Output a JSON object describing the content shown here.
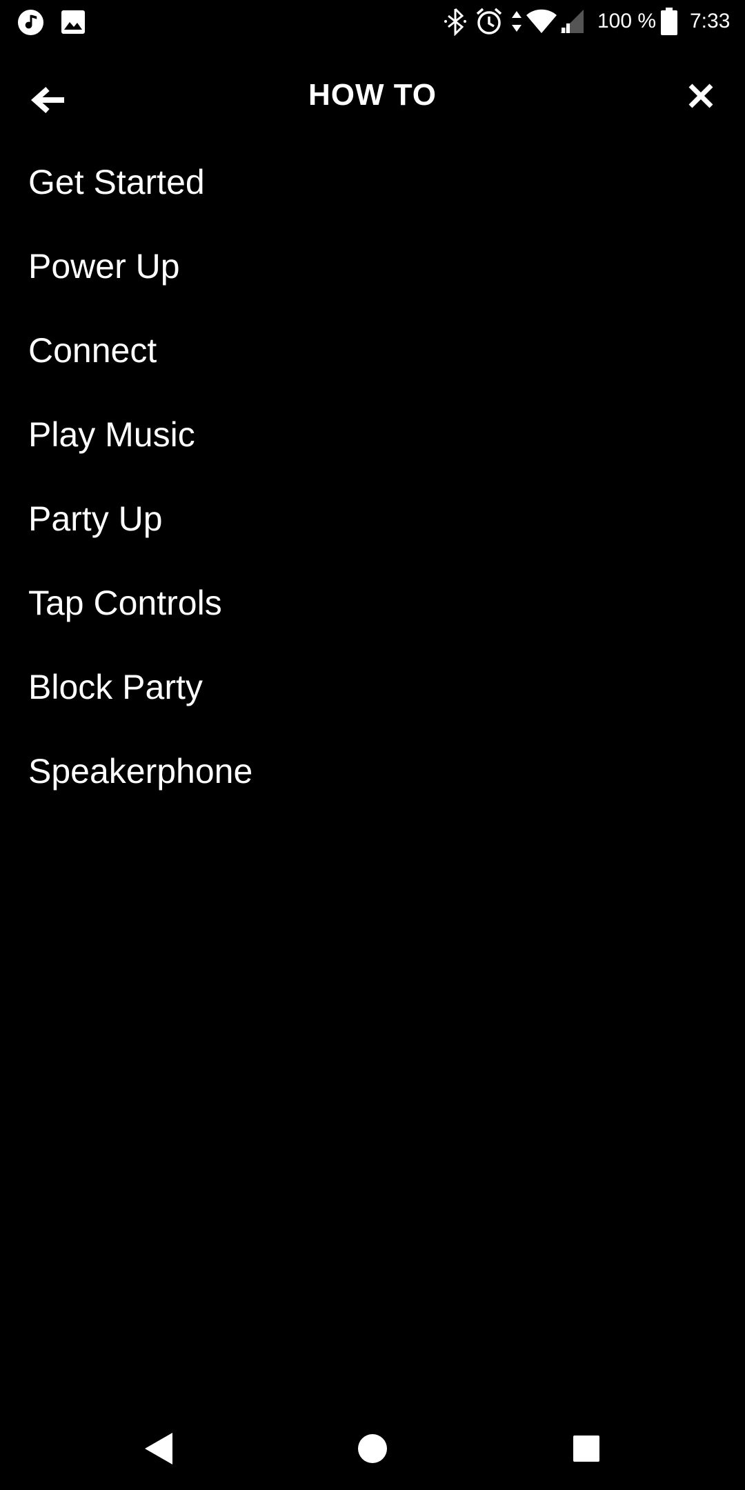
{
  "status_bar": {
    "battery_percent": "100 %",
    "time": "7:33",
    "icons": [
      "music-note-icon",
      "image-icon",
      "bluetooth-icon",
      "alarm-icon",
      "data-arrows-icon",
      "wifi-icon",
      "cellular-signal-icon",
      "battery-icon"
    ]
  },
  "header": {
    "title": "HOW TO",
    "back_icon": "arrow-left-icon",
    "close_icon": "close-icon"
  },
  "menu": {
    "items": [
      {
        "label": "Get Started"
      },
      {
        "label": "Power Up"
      },
      {
        "label": "Connect"
      },
      {
        "label": "Play Music"
      },
      {
        "label": "Party Up"
      },
      {
        "label": "Tap Controls"
      },
      {
        "label": "Block Party"
      },
      {
        "label": "Speakerphone"
      }
    ]
  },
  "nav_bar": {
    "icons": [
      "nav-back-icon",
      "nav-home-icon",
      "nav-recents-icon"
    ]
  },
  "colors": {
    "background": "#000000",
    "foreground": "#ffffff"
  }
}
